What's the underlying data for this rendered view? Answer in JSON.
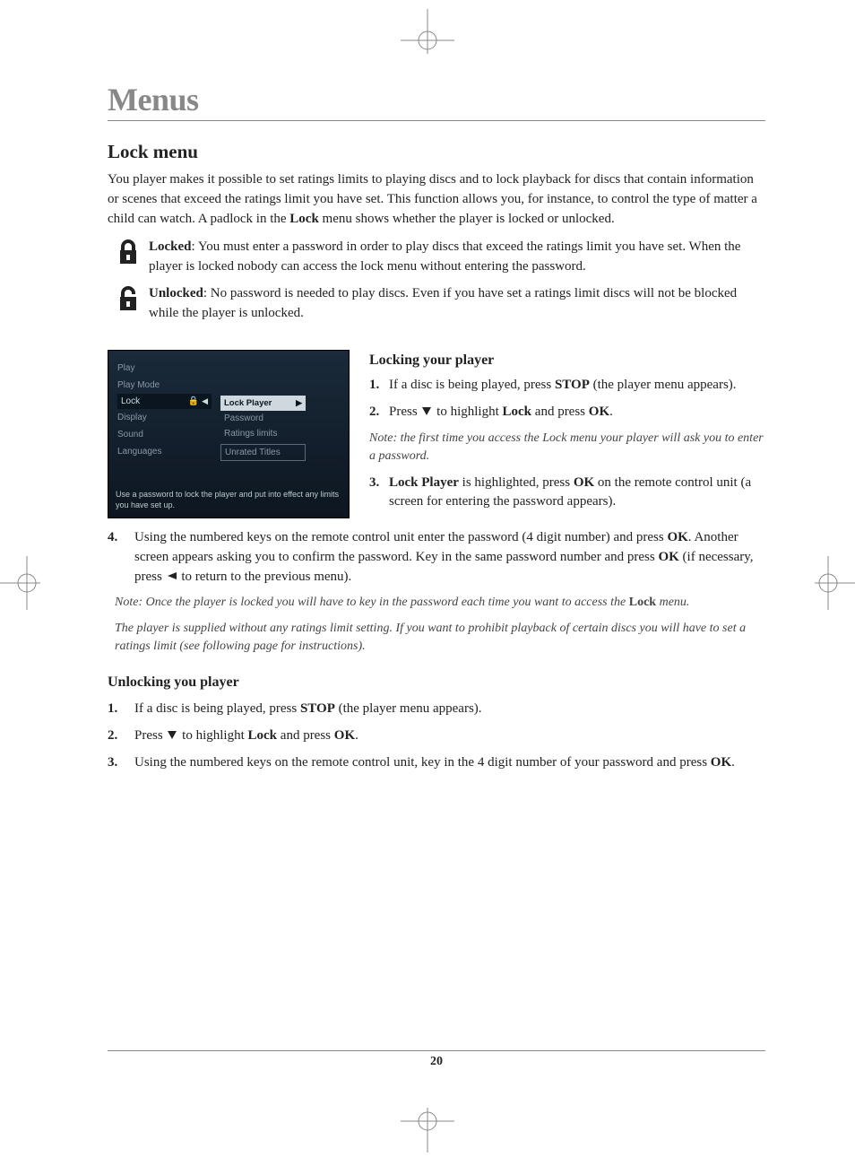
{
  "page_title": "Menus",
  "section_title": "Lock menu",
  "intro_p1a": "You player makes it possible to set ratings limits to playing discs and to lock playback for discs that contain information or scenes that exceed the ratings limit you have set. This function allows you, for instance, to control the type of matter a child can watch. A padlock in the ",
  "intro_p1b_bold": "Lock",
  "intro_p1c": " menu shows whether the player is locked or unlocked.",
  "locked_label": "Locked",
  "locked_text": ": You must enter a password in order to play discs that exceed the ratings limit you have set. When the player is locked nobody can access the lock menu without entering the password.",
  "unlocked_label": "Unlocked",
  "unlocked_text": ": No password is needed to play discs. Even if you have set a ratings limit discs will not be blocked while the player is unlocked.",
  "menu": {
    "left": [
      "Play",
      "Play Mode",
      "Lock",
      "Display",
      "Sound",
      "Languages"
    ],
    "right": [
      "Lock Player",
      "Password",
      "Ratings limits",
      "Unrated Titles"
    ],
    "caption": "Use a password to lock the player and put into effect any limits you have set up."
  },
  "locking_heading": "Locking your player",
  "l1_a": "If a disc is being played, press ",
  "l1_b": "STOP",
  "l1_c": " (the player menu appears).",
  "l2_a": "Press ",
  "l2_b": " to highlight ",
  "l2_c": "Lock",
  "l2_d": " and press ",
  "l2_e": "OK",
  "l2_f": ".",
  "l2_note": "Note: the first time you access the Lock menu your player will ask you to enter a password.",
  "l3_a": "Lock Player",
  "l3_b": " is highlighted, press ",
  "l3_c": "OK",
  "l3_d": " on the remote control unit (a screen for entering the password appears).",
  "l4_a": "Using the numbered keys on the remote control unit enter the password (4 digit number) and press ",
  "l4_b": "OK",
  "l4_c": ". Another screen appears asking you to confirm the password. Key in the same password number and press ",
  "l4_d": "OK",
  "l4_e": " (if necessary, press ",
  "l4_f": " to return to the previous menu).",
  "note4a_a": "Note: Once the player is locked you will have to key in the password each time you want to access the ",
  "note4a_bold": "Lock",
  "note4a_b": " menu.",
  "note4b": "The player is supplied without any ratings limit setting. If you want to prohibit playback of certain discs you will have to set a ratings limit (see following page for instructions).",
  "unlocking_heading": "Unlocking you player",
  "u1_a": "If a disc is being played, press ",
  "u1_b": "STOP",
  "u1_c": " (the player menu appears).",
  "u2_a": "Press ",
  "u2_b": " to highlight ",
  "u2_c": "Lock",
  "u2_d": " and press ",
  "u2_e": "OK",
  "u2_f": ".",
  "u3_a": "Using the numbered keys on the remote control unit, key in the 4 digit number of your password and press ",
  "u3_b": "OK",
  "u3_c": ".",
  "page_number": "20",
  "nums": {
    "n1": "1.",
    "n2": "2.",
    "n3": "3.",
    "n4": "4."
  }
}
